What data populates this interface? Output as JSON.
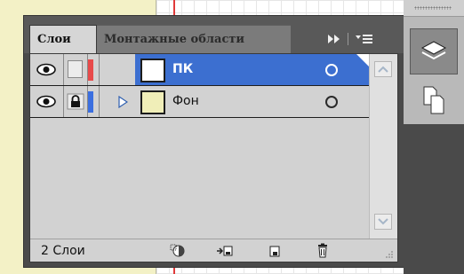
{
  "tabs": {
    "active_label": "Слои",
    "inactive_label": "Монтажные области"
  },
  "layers": [
    {
      "name": "ПК",
      "selected": true,
      "locked": false,
      "color": "#e84a4a",
      "thumbnail": "white",
      "expandable": false
    },
    {
      "name": "Фон",
      "selected": false,
      "locked": true,
      "color": "#3b6fe0",
      "thumbnail": "yellow",
      "expandable": true
    }
  ],
  "footer": {
    "count_label": "2 Слои",
    "buttons": [
      "make-clipping-mask-icon",
      "create-sublayer-icon",
      "create-new-layer-icon",
      "delete-layer-icon"
    ]
  },
  "dock": {
    "buttons": [
      "layers-panel-icon",
      "artboards-panel-icon"
    ]
  },
  "colors": {
    "selection": "#3c6fd0",
    "panel_bg": "#d2d2d2",
    "artboard": "#f3f1c6",
    "guide": "#e03a3a"
  }
}
